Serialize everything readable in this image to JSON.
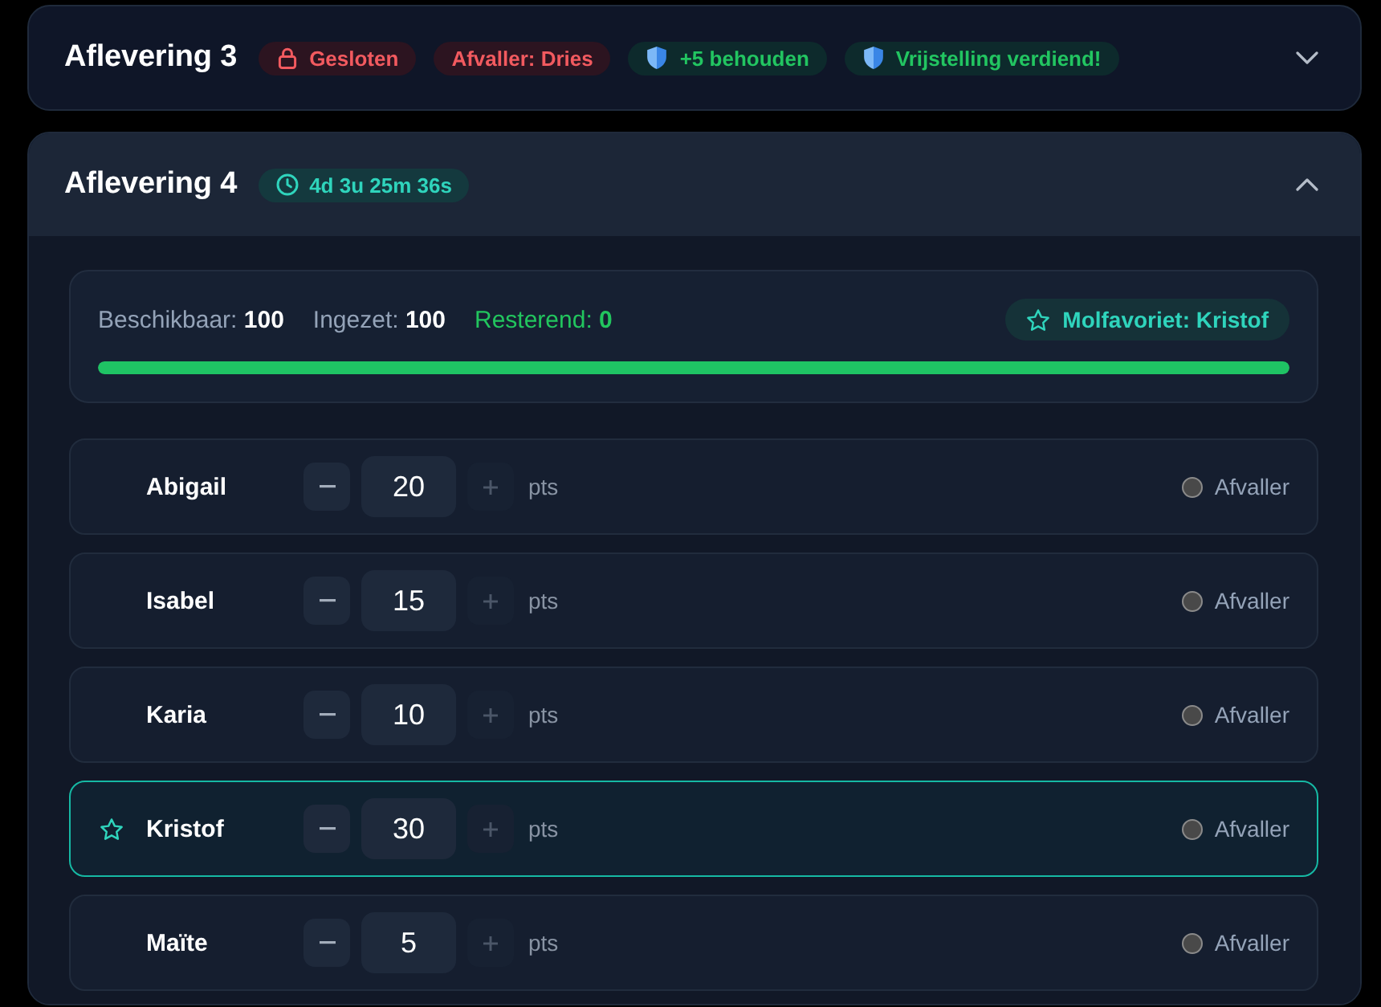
{
  "episodes": [
    {
      "title": "Aflevering 3",
      "expanded": false,
      "badges": [
        {
          "kind": "locked",
          "text": "Gesloten"
        },
        {
          "kind": "eliminated",
          "text": "Afvaller: Dries"
        },
        {
          "kind": "shield",
          "text": "+5 behouden"
        },
        {
          "kind": "shield",
          "text": "Vrijstelling verdiend!"
        }
      ]
    },
    {
      "title": "Aflevering 4",
      "expanded": true,
      "badges": [
        {
          "kind": "timer",
          "text": "4d 3u 25m 36s"
        }
      ],
      "summary": {
        "stats": [
          {
            "kind": "neutral",
            "label": "Beschikbaar:",
            "value": "100"
          },
          {
            "kind": "neutral",
            "label": "Ingezet:",
            "value": "100"
          },
          {
            "kind": "positive",
            "label": "Resterend:",
            "value": "0"
          }
        ],
        "favorite": "Molfavoriet: Kristof",
        "level": 1
      },
      "candidates": [
        {
          "name": "Abigail",
          "favorite": false,
          "points": "20",
          "unit": "pts",
          "increase_disabled": true,
          "eliminated": false,
          "eliminated_label": "Afvaller"
        },
        {
          "name": "Isabel",
          "favorite": false,
          "points": "15",
          "unit": "pts",
          "increase_disabled": true,
          "eliminated": false,
          "eliminated_label": "Afvaller"
        },
        {
          "name": "Karia",
          "favorite": false,
          "points": "10",
          "unit": "pts",
          "increase_disabled": true,
          "eliminated": false,
          "eliminated_label": "Afvaller"
        },
        {
          "name": "Kristof",
          "favorite": true,
          "points": "30",
          "unit": "pts",
          "increase_disabled": true,
          "eliminated": false,
          "eliminated_label": "Afvaller"
        },
        {
          "name": "Maïte",
          "favorite": false,
          "points": "5",
          "unit": "pts",
          "increase_disabled": true,
          "eliminated": false,
          "eliminated_label": "Afvaller"
        }
      ]
    }
  ]
}
